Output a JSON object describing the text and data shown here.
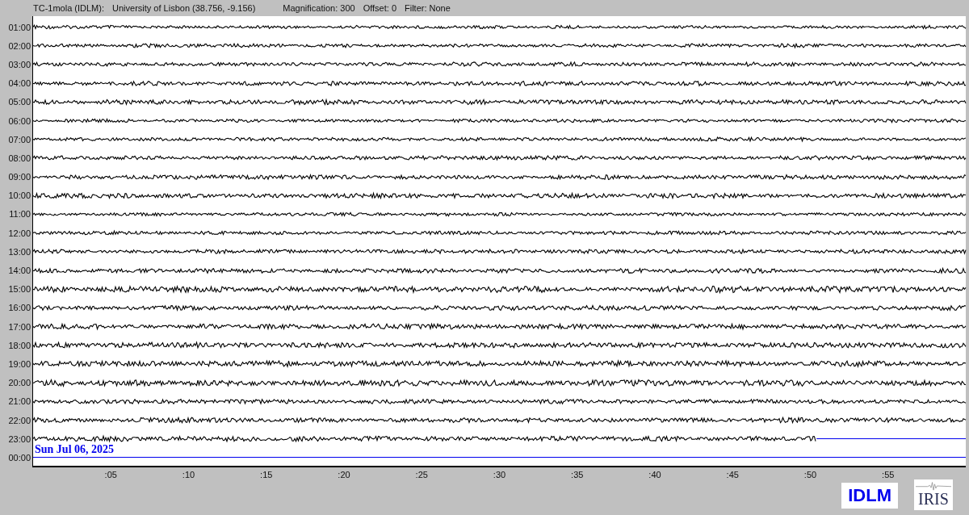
{
  "header": {
    "station": "TC-1mola (IDLM):",
    "location": "University of Lisbon (38.756, -9.156)",
    "magnification": "Magnification: 300",
    "offset": "Offset: 0",
    "filter": "Filter: None"
  },
  "rows": [
    {
      "time": "01:00",
      "kind": "full"
    },
    {
      "time": "02:00",
      "kind": "full"
    },
    {
      "time": "03:00",
      "kind": "full"
    },
    {
      "time": "04:00",
      "kind": "full"
    },
    {
      "time": "05:00",
      "kind": "full"
    },
    {
      "time": "06:00",
      "kind": "full"
    },
    {
      "time": "07:00",
      "kind": "full"
    },
    {
      "time": "08:00",
      "kind": "full"
    },
    {
      "time": "09:00",
      "kind": "full"
    },
    {
      "time": "10:00",
      "kind": "full"
    },
    {
      "time": "11:00",
      "kind": "full"
    },
    {
      "time": "12:00",
      "kind": "full"
    },
    {
      "time": "13:00",
      "kind": "full"
    },
    {
      "time": "14:00",
      "kind": "full"
    },
    {
      "time": "15:00",
      "kind": "full"
    },
    {
      "time": "16:00",
      "kind": "full"
    },
    {
      "time": "17:00",
      "kind": "full"
    },
    {
      "time": "18:00",
      "kind": "full"
    },
    {
      "time": "19:00",
      "kind": "full"
    },
    {
      "time": "20:00",
      "kind": "full"
    },
    {
      "time": "21:00",
      "kind": "full"
    },
    {
      "time": "22:00",
      "kind": "full"
    },
    {
      "time": "23:00",
      "kind": "partial",
      "level": 0.84
    },
    {
      "time": "00:00",
      "kind": "empty",
      "date": "Sun Jul 06, 2025"
    }
  ],
  "x_ticks": [
    ":05",
    ":10",
    ":15",
    ":20",
    ":25",
    ":30",
    ":35",
    ":40",
    ":45",
    ":50",
    ":55"
  ],
  "logos": {
    "network": "IDLM",
    "consortium": "IRIS"
  }
}
